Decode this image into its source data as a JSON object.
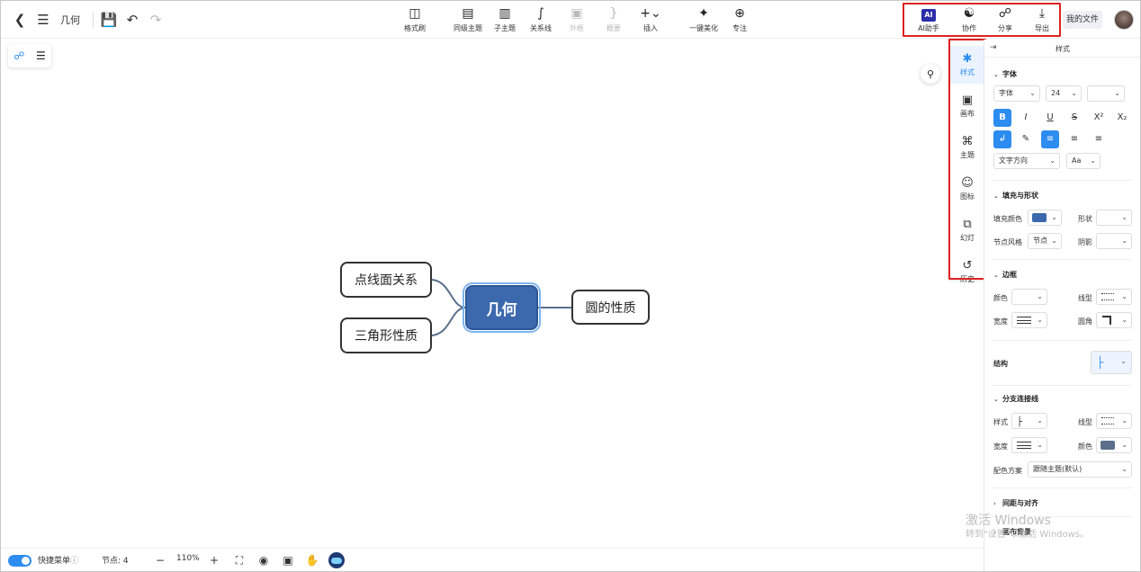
{
  "app": {
    "doc_title": "几何",
    "my_files": "我的文件"
  },
  "toolbar": {
    "tools": [
      {
        "label": "格式刷",
        "icon": "format-painter-icon",
        "disabled": false
      },
      {
        "label": "同级主题",
        "icon": "sibling-topic-icon",
        "disabled": false
      },
      {
        "label": "子主题",
        "icon": "child-topic-icon",
        "disabled": false
      },
      {
        "label": "关系线",
        "icon": "relation-line-icon",
        "disabled": false
      },
      {
        "label": "外框",
        "icon": "boundary-icon",
        "disabled": true
      },
      {
        "label": "概要",
        "icon": "summary-icon",
        "disabled": true
      },
      {
        "label": "插入",
        "icon": "insert-icon",
        "disabled": false
      },
      {
        "label": "一键美化",
        "icon": "magic-wand-icon",
        "disabled": false
      },
      {
        "label": "专注",
        "icon": "focus-icon",
        "disabled": false
      }
    ],
    "right_tools": [
      {
        "label": "AI助手",
        "icon": "ai-assistant-icon"
      },
      {
        "label": "协作",
        "icon": "collaborate-icon"
      },
      {
        "label": "分享",
        "icon": "share-icon"
      },
      {
        "label": "导出",
        "icon": "export-icon"
      }
    ],
    "ai_badge": "AI"
  },
  "mindmap": {
    "root": "几何",
    "left_children": [
      "点线面关系",
      "三角形性质"
    ],
    "right_children": [
      "圆的性质"
    ],
    "line_color": "#5b6f8c"
  },
  "rail_tabs": [
    {
      "label": "样式",
      "icon": "style-icon",
      "active": true
    },
    {
      "label": "画布",
      "icon": "canvas-icon",
      "active": false
    },
    {
      "label": "主题",
      "icon": "theme-icon",
      "active": false
    },
    {
      "label": "图标",
      "icon": "emoji-icon",
      "active": false
    },
    {
      "label": "幻灯",
      "icon": "slides-icon",
      "active": false
    },
    {
      "label": "历史",
      "icon": "history-icon",
      "active": false
    }
  ],
  "panel": {
    "title": "样式",
    "font": {
      "section": "字体",
      "family": "字体",
      "size": "24",
      "color": "",
      "direction": "文字方向",
      "case": "Aa"
    },
    "fill": {
      "section": "填充与形状",
      "fill_color_label": "填充颜色",
      "fill_color": "#3c68ad",
      "shape_label": "形状",
      "node_style_label": "节点风格",
      "node_style_value": "节点",
      "shadow_label": "阴影"
    },
    "border": {
      "section": "边框",
      "color_label": "颜色",
      "line_type_label": "线型",
      "width_label": "宽度",
      "corner_label": "圆角"
    },
    "structure_label": "结构",
    "branch": {
      "section": "分支连接线",
      "style_label": "样式",
      "line_type_label": "线型",
      "width_label": "宽度",
      "color_label": "颜色",
      "color": "#5b6f8c",
      "scheme_label": "配色方案",
      "scheme_value": "跟随主题(默认)"
    },
    "spacing_section": "间距与对齐",
    "background_section": "画布背景"
  },
  "bottom": {
    "quick_menu": "快捷菜单",
    "nodes_label": "节点: 4",
    "zoom": "110%"
  },
  "watermark": {
    "line1": "激活 Windows",
    "line2": "转到\"设置\"以激活 Windows。"
  }
}
